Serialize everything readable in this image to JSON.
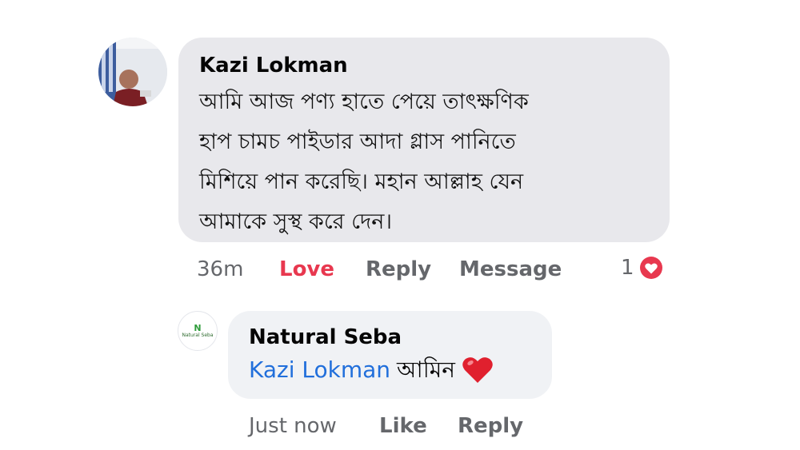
{
  "main_comment": {
    "author": "Kazi Lokman",
    "text": "আমি আজ পণ্য হাতে পেয়ে তাৎক্ষণিক\nহাপ চামচ পাইডার আদা গ্লাস পানিতে\nমিশিয়ে পান করেছি। মহান আল্লাহ যেন\nআমাকে সুস্থ করে দেন।",
    "time": "36m",
    "actions": {
      "love": "Love",
      "reply": "Reply",
      "message": "Message"
    },
    "reaction_count": "1",
    "reaction_icon": "heart-reaction-icon",
    "love_color": "#e8384f"
  },
  "reply_comment": {
    "author": "Natural Seba",
    "mention": "Kazi Lokman",
    "text": "আমিন",
    "emoji": "❤️",
    "time": "Just now",
    "actions": {
      "like": "Like",
      "reply": "Reply"
    },
    "avatar_logo": {
      "mark": "N",
      "text": "Natural Seba"
    },
    "mention_color": "#216fdb"
  }
}
